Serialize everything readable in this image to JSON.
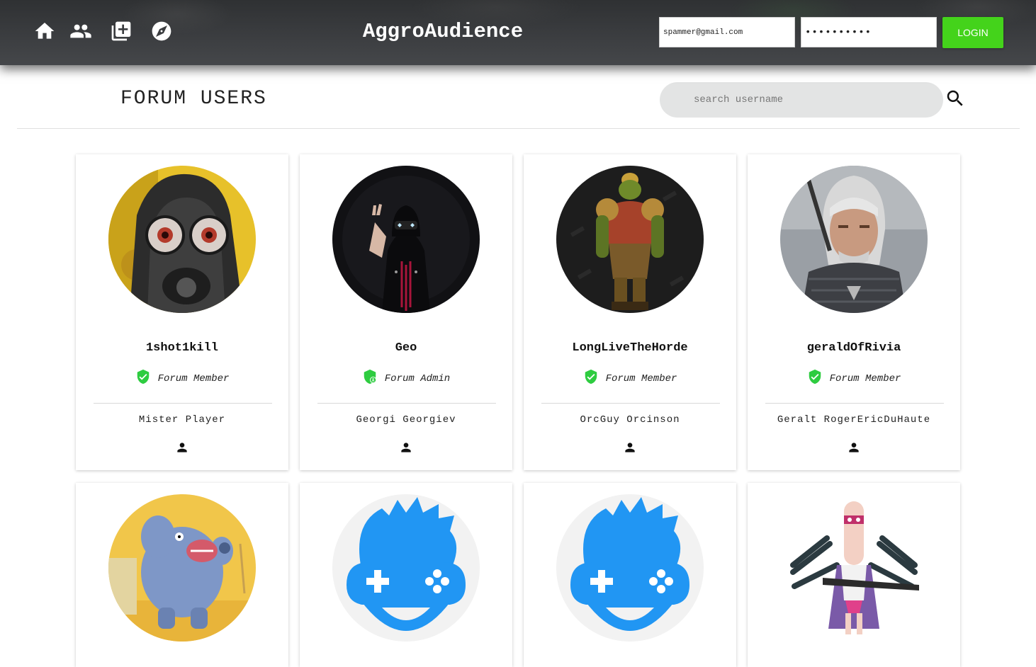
{
  "app": {
    "brand": "AggroAudience",
    "nav": [
      "home-icon",
      "users-icon",
      "add-post-icon",
      "explore-icon"
    ]
  },
  "login": {
    "email_value": "spammer@gmail.com",
    "password_value": "••••••••••",
    "button_label": "LOGIN",
    "button_color": "#44d31b"
  },
  "page": {
    "title": "FORUM USERS",
    "search_placeholder": "search username",
    "search_icon": "search-icon"
  },
  "users": [
    {
      "username": "1shot1kill",
      "role": "Forum Member",
      "role_icon": "verified-shield-icon",
      "full_name": "Mister Player",
      "avatar": "gas-mask-avatar"
    },
    {
      "username": "Geo",
      "role": "Forum Admin",
      "role_icon": "admin-shield-icon",
      "full_name": "Georgi Georgiev",
      "avatar": "masked-figure-avatar"
    },
    {
      "username": "LongLiveTheHorde",
      "role": "Forum Member",
      "role_icon": "verified-shield-icon",
      "full_name": "OrcGuy Orcinson",
      "avatar": "orc-warrior-avatar"
    },
    {
      "username": "geraldOfRivia",
      "role": "Forum Member",
      "role_icon": "verified-shield-icon",
      "full_name": "Geralt RogerEricDuHaute",
      "avatar": "witcher-avatar"
    },
    {
      "avatar": "cartoon-yeti-avatar"
    },
    {
      "avatar": "gamepad-face-avatar"
    },
    {
      "avatar": "gamepad-face-avatar"
    },
    {
      "avatar": "sniper-character-avatar"
    }
  ],
  "colors": {
    "accent_green": "#44d31b",
    "gamer_blue": "#2196f3",
    "topbar": "#3b3d40"
  }
}
